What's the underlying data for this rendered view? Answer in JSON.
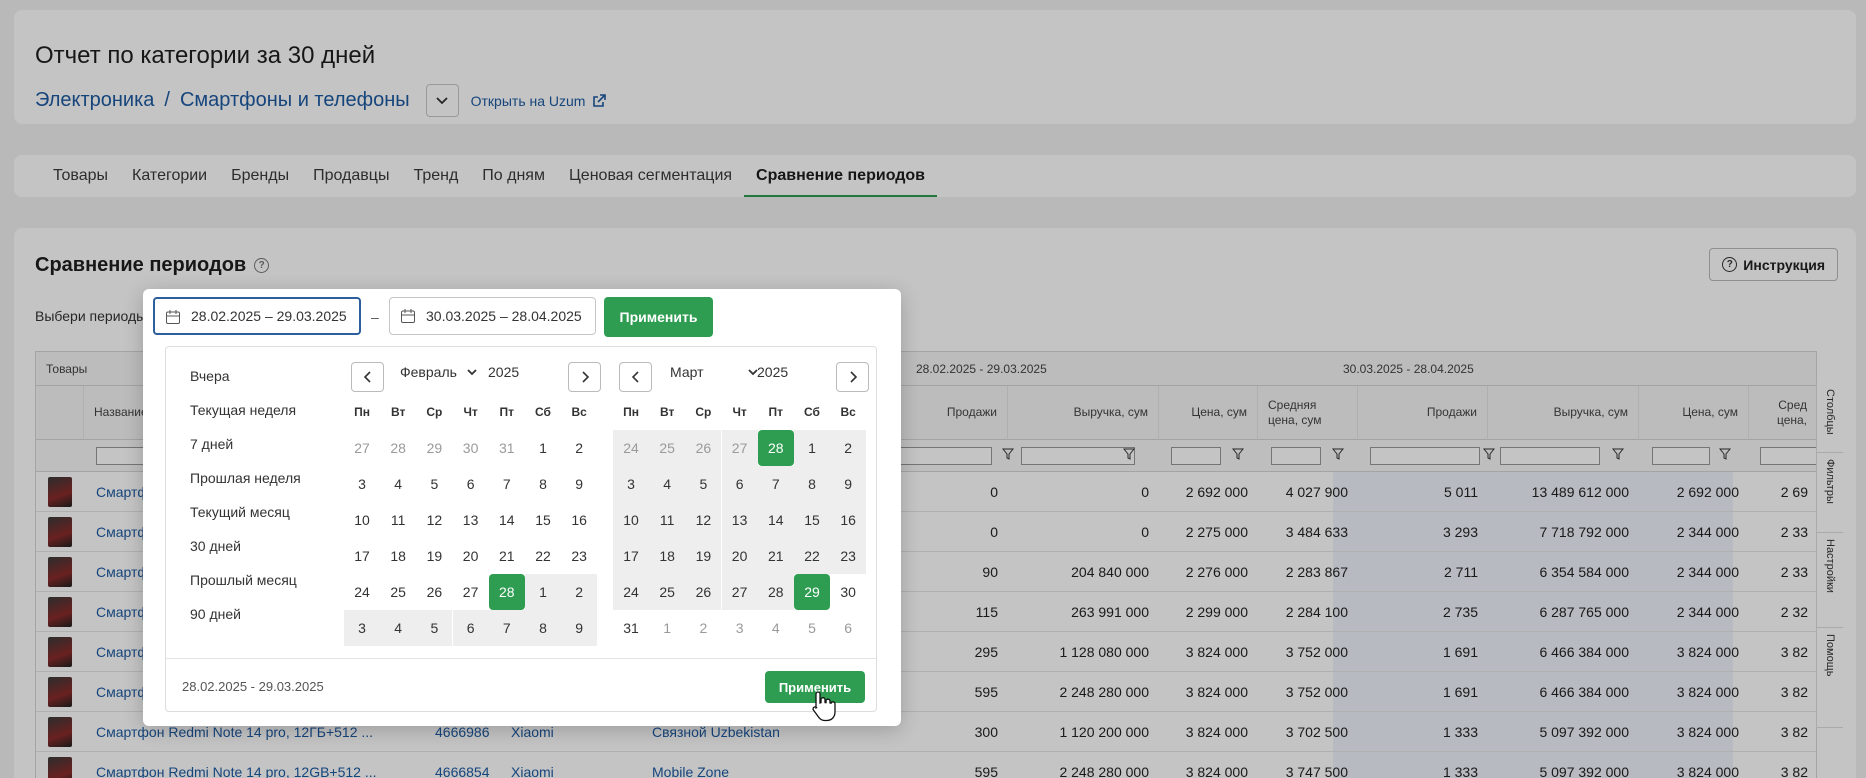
{
  "header": {
    "title": "Отчет по категории за 30 дней",
    "breadcrumb": [
      "Электроника",
      "Смартфоны и телефоны"
    ],
    "breadcrumb_sep": "/",
    "open_link": "Открыть на Uzum"
  },
  "tabs": [
    "Товары",
    "Категории",
    "Бренды",
    "Продавцы",
    "Тренд",
    "По дням",
    "Ценовая сегментация",
    "Сравнение периодов"
  ],
  "active_tab": "Сравнение периодов",
  "main": {
    "title": "Сравнение периодов",
    "help_icon": "?",
    "instruction_button": "Инструкция",
    "periods_label": "Выбери периоды"
  },
  "table": {
    "group_headers": {
      "left": "Товары",
      "period1": "28.02.2025 - 29.03.2025",
      "period2": "30.03.2025 - 28.04.2025"
    },
    "col_name": "Название",
    "p1_cols": [
      "Продажи",
      "Выручка, сум",
      "Цена, сум",
      "Средняя цена, сум"
    ],
    "p2_cols": [
      "Продажи",
      "Выручка, сум",
      "Цена, сум",
      "Сред цена,"
    ],
    "rows": [
      {
        "name": "Смартфон",
        "sku": "",
        "brand": "",
        "seller": "",
        "p1": [
          "0",
          "0",
          "2 692 000",
          "4 027 900"
        ],
        "p2": [
          "5 011",
          "13 489 612 000",
          "2 692 000",
          "2 69"
        ]
      },
      {
        "name": "Смартфон",
        "sku": "",
        "brand": "",
        "seller": "",
        "p1": [
          "0",
          "0",
          "2 275 000",
          "3 484 633"
        ],
        "p2": [
          "3 293",
          "7 718 792 000",
          "2 344 000",
          "2 33"
        ]
      },
      {
        "name": "Смартфон",
        "sku": "",
        "brand": "",
        "seller": "",
        "p1": [
          "90",
          "204 840 000",
          "2 276 000",
          "2 283 867"
        ],
        "p2": [
          "2 711",
          "6 354 584 000",
          "2 344 000",
          "2 33"
        ]
      },
      {
        "name": "Смартфон",
        "sku": "",
        "brand": "",
        "seller": "",
        "p1": [
          "115",
          "263 991 000",
          "2 299 000",
          "2 284 100"
        ],
        "p2": [
          "2 735",
          "6 287 765 000",
          "2 344 000",
          "2 32"
        ]
      },
      {
        "name": "Смартфон",
        "sku": "",
        "brand": "",
        "seller": "",
        "p1": [
          "295",
          "1 128 080 000",
          "3 824 000",
          "3 752 000"
        ],
        "p2": [
          "1 691",
          "6 466 384 000",
          "3 824 000",
          "3 82"
        ]
      },
      {
        "name": "Смартфон",
        "sku": "",
        "brand": "",
        "seller": "",
        "p1": [
          "595",
          "2 248 280 000",
          "3 824 000",
          "3 752 000"
        ],
        "p2": [
          "1 691",
          "6 466 384 000",
          "3 824 000",
          "3 82"
        ]
      },
      {
        "name": "Смартфон Redmi Note 14 pro, 12ГБ+512 ...",
        "sku": "4666986",
        "brand": "Xiaomi",
        "seller": "Связной Uzbekistan",
        "p1": [
          "300",
          "1 120 200 000",
          "3 824 000",
          "3 702 500"
        ],
        "p2": [
          "1 333",
          "5 097 392 000",
          "3 824 000",
          "3 82"
        ]
      },
      {
        "name": "Смартфон Redmi Note 14 pro, 12GB+512 ...",
        "sku": "4666854",
        "brand": "Xiaomi",
        "seller": "Mobile Zone",
        "p1": [
          "595",
          "2 248 280 000",
          "3 824 000",
          "3 747 500"
        ],
        "p2": [
          "1 333",
          "5 097 392 000",
          "3 824 000",
          "3 82"
        ]
      }
    ]
  },
  "side_panel": [
    "Столбцы",
    "Фильтры",
    "Настройки",
    "Помощь"
  ],
  "datepicker": {
    "range1": "28.02.2025 – 29.03.2025",
    "range2": "30.03.2025 – 28.04.2025",
    "dash": "–",
    "apply": "Применить",
    "presets": [
      "Вчера",
      "Текущая неделя",
      "7 дней",
      "Прошлая неделя",
      "Текущий месяц",
      "30 дней",
      "Прошлый месяц",
      "90 дней"
    ],
    "weekdays": [
      "Пн",
      "Вт",
      "Ср",
      "Чт",
      "Пт",
      "Сб",
      "Вс"
    ],
    "left_month": {
      "month": "Февраль",
      "year": "2025",
      "days": [
        [
          "27",
          "28",
          "29",
          "30",
          "31",
          "1",
          "2"
        ],
        [
          "3",
          "4",
          "5",
          "6",
          "7",
          "8",
          "9"
        ],
        [
          "10",
          "11",
          "12",
          "13",
          "14",
          "15",
          "16"
        ],
        [
          "17",
          "18",
          "19",
          "20",
          "21",
          "22",
          "23"
        ],
        [
          "24",
          "25",
          "26",
          "27",
          "28",
          "1",
          "2"
        ],
        [
          "3",
          "4",
          "5",
          "6",
          "7",
          "8",
          "9"
        ]
      ]
    },
    "right_month": {
      "month": "Март",
      "year": "2025",
      "days": [
        [
          "24",
          "25",
          "26",
          "27",
          "28",
          "1",
          "2"
        ],
        [
          "3",
          "4",
          "5",
          "6",
          "7",
          "8",
          "9"
        ],
        [
          "10",
          "11",
          "12",
          "13",
          "14",
          "15",
          "16"
        ],
        [
          "17",
          "18",
          "19",
          "20",
          "21",
          "22",
          "23"
        ],
        [
          "24",
          "25",
          "26",
          "27",
          "28",
          "29",
          "30"
        ],
        [
          "31",
          "1",
          "2",
          "3",
          "4",
          "5",
          "6"
        ]
      ]
    },
    "footer_range": "28.02.2025 - 29.03.2025",
    "footer_apply": "Применить"
  },
  "colors": {
    "accent": "#2e9d51",
    "link": "#1d5aa2"
  }
}
